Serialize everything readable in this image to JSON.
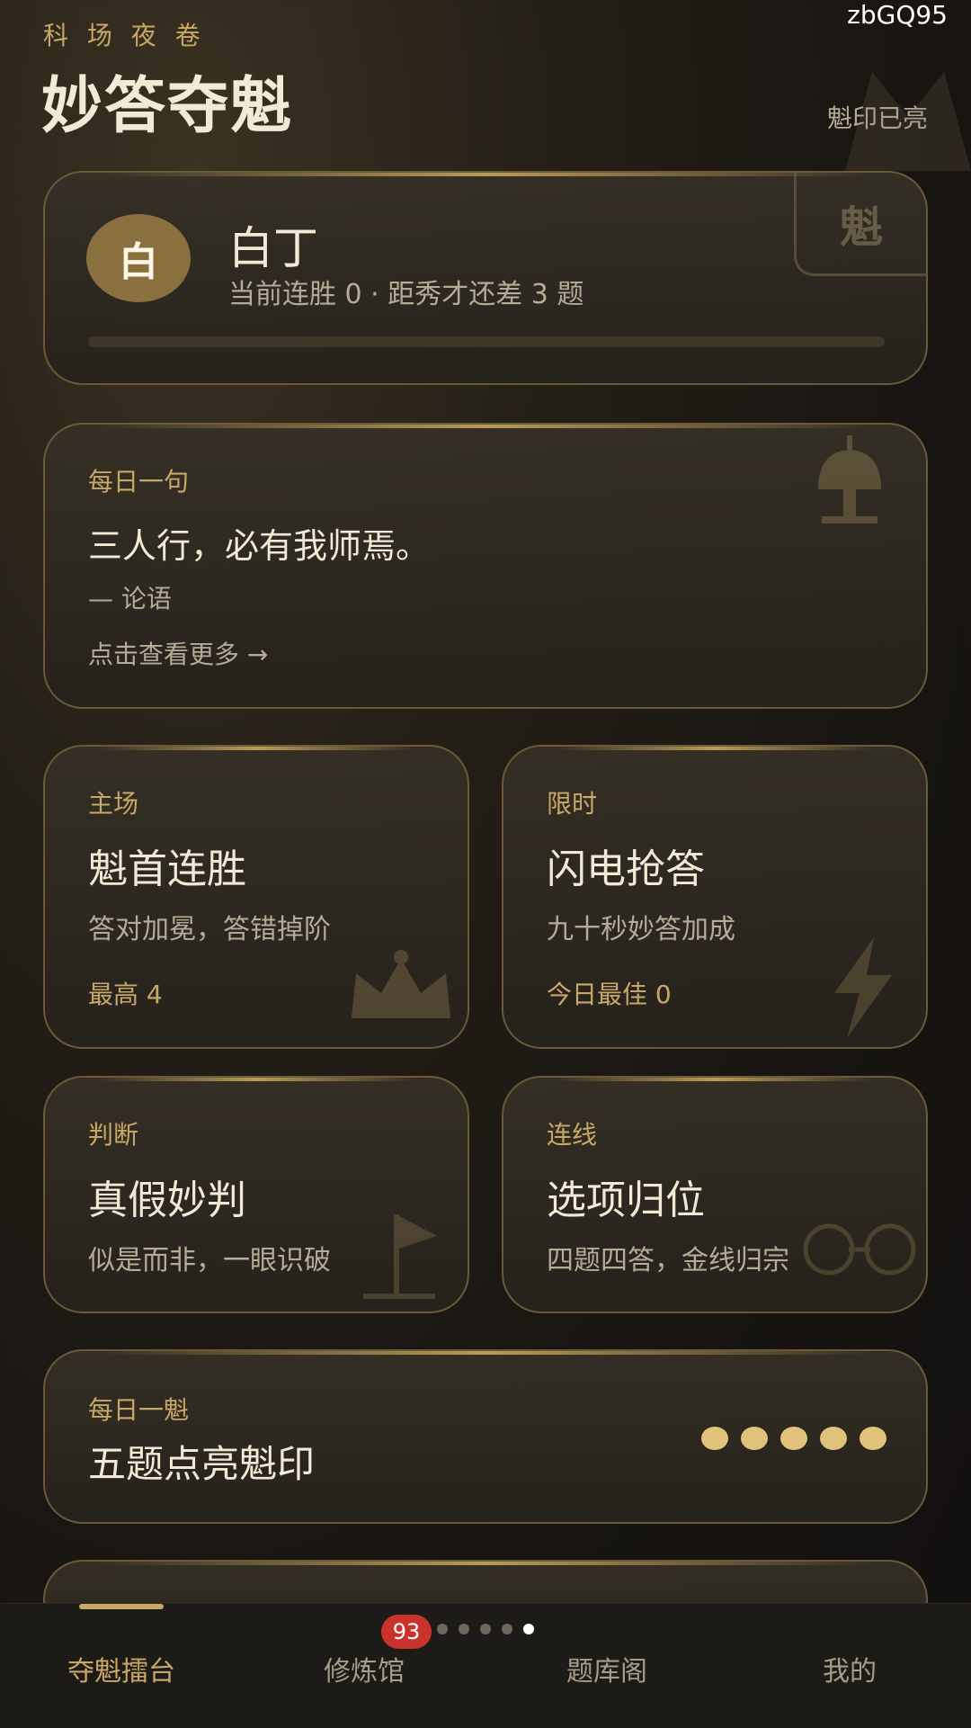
{
  "header": {
    "subtitle": "科 场 夜 卷",
    "title": "妙答夺魁",
    "badge_text": "魁印已亮",
    "watermark": "zbGQ95",
    "seal_char": "魁"
  },
  "profile": {
    "avatar_char": "白",
    "rank": "白丁",
    "status": "当前连胜 0 · 距秀才还差 3 题",
    "progress_fraction": 0
  },
  "quote": {
    "label": "每日一句",
    "text": "三人行，必有我师焉。",
    "source": "— 论语",
    "more_link": "点击查看更多 →"
  },
  "modes": [
    {
      "tag": "主场",
      "title": "魁首连胜",
      "desc": "答对加冕，答错掉阶",
      "stat": "最高 4"
    },
    {
      "tag": "限时",
      "title": "闪电抢答",
      "desc": "九十秒妙答加成",
      "stat": "今日最佳 0"
    },
    {
      "tag": "判断",
      "title": "真假妙判",
      "desc": "似是而非，一眼识破"
    },
    {
      "tag": "连线",
      "title": "选项归位",
      "desc": "四题四答，金线归宗"
    }
  ],
  "daily": {
    "label": "每日一魁",
    "title": "五题点亮魁印",
    "dots_lit": 5
  },
  "nav": {
    "items": [
      "夺魁擂台",
      "修炼馆",
      "题库阁",
      "我的"
    ],
    "active_index": 0,
    "badge_count": "93",
    "page_dots": 5,
    "page_active": 4
  },
  "colors": {
    "accent_gold": "#c9a867",
    "badge_red": "#c9332b",
    "dot_gold": "#e0c27a"
  }
}
